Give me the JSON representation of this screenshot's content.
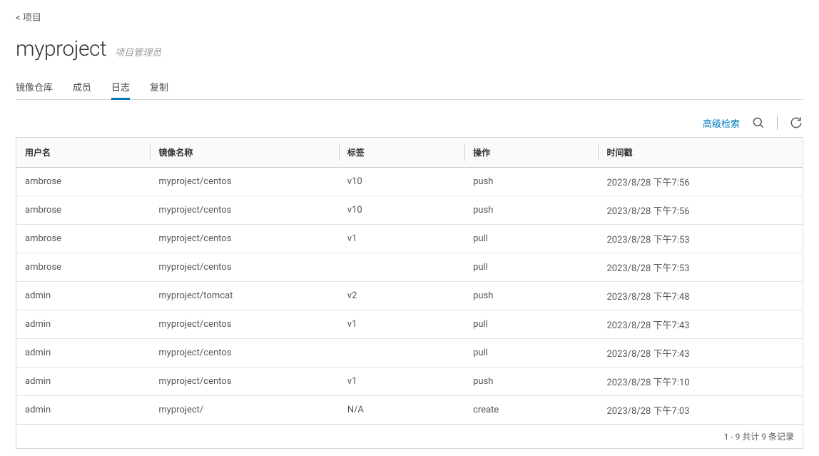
{
  "breadcrumb": {
    "back_arrow": "<",
    "label": "项目"
  },
  "project": {
    "name": "myproject",
    "role": "项目管理员"
  },
  "tabs": [
    {
      "id": "repo",
      "label": "镜像仓库",
      "active": false
    },
    {
      "id": "members",
      "label": "成员",
      "active": false
    },
    {
      "id": "logs",
      "label": "日志",
      "active": true
    },
    {
      "id": "replication",
      "label": "复制",
      "active": false
    }
  ],
  "toolbar": {
    "advanced_search": "高级检索"
  },
  "columns": {
    "user": "用户名",
    "repo": "镜像名称",
    "tag": "标签",
    "op": "操作",
    "time": "时间戳"
  },
  "rows": [
    {
      "user": "ambrose",
      "repo": "myproject/centos",
      "tag": "v10",
      "op": "push",
      "time": "2023/8/28 下午7:56"
    },
    {
      "user": "ambrose",
      "repo": "myproject/centos",
      "tag": "v10",
      "op": "push",
      "time": "2023/8/28 下午7:56"
    },
    {
      "user": "ambrose",
      "repo": "myproject/centos",
      "tag": "v1",
      "op": "pull",
      "time": "2023/8/28 下午7:53"
    },
    {
      "user": "ambrose",
      "repo": "myproject/centos",
      "tag": "",
      "op": "pull",
      "time": "2023/8/28 下午7:53"
    },
    {
      "user": "admin",
      "repo": "myproject/tomcat",
      "tag": "v2",
      "op": "push",
      "time": "2023/8/28 下午7:48"
    },
    {
      "user": "admin",
      "repo": "myproject/centos",
      "tag": "v1",
      "op": "pull",
      "time": "2023/8/28 下午7:43"
    },
    {
      "user": "admin",
      "repo": "myproject/centos",
      "tag": "",
      "op": "pull",
      "time": "2023/8/28 下午7:43"
    },
    {
      "user": "admin",
      "repo": "myproject/centos",
      "tag": "v1",
      "op": "push",
      "time": "2023/8/28 下午7:10"
    },
    {
      "user": "admin",
      "repo": "myproject/",
      "tag": "N/A",
      "op": "create",
      "time": "2023/8/28 下午7:03"
    }
  ],
  "footer": {
    "pagination": "1 - 9 共计 9 条记录"
  }
}
